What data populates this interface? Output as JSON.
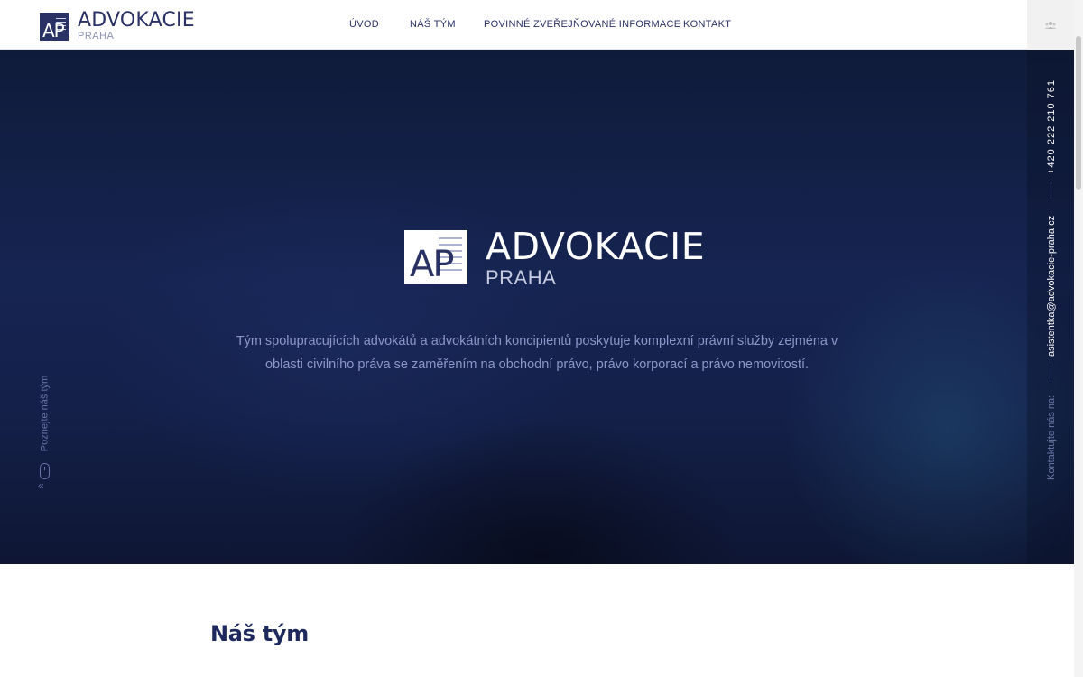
{
  "header": {
    "logo": {
      "mark": "AP",
      "title": "ADVOKACIE",
      "subtitle": "PRAHA"
    },
    "nav": [
      {
        "label": "ÚVOD"
      },
      {
        "label": "NÁŠ TÝM"
      },
      {
        "label": "POVINNÉ ZVEŘEJŇOVANÉ INFORMACE"
      },
      {
        "label": "KONTAKT"
      }
    ],
    "button_icon": "group-icon"
  },
  "hero": {
    "logo": {
      "mark": "AP",
      "title": "ADVOKACIE",
      "subtitle": "PRAHA"
    },
    "description": "Tým spolupracujících advokátů a advokátních koncipientů poskytuje komplexní právní služby zejména v oblasti civilního práva se zaměřením na obchodní právo, právo korporací a právo nemovitostí.",
    "scroll_hint": "Poznejte náš tým",
    "scroll_icon": "mouse-icon",
    "contact": {
      "phone": "+420 222 210 761",
      "email": "asistentka@advokacie-praha.cz",
      "label": "Kontaktujte nás na:"
    }
  },
  "section": {
    "title": "Náš tým"
  },
  "colors": {
    "brand": "#2a3164",
    "hero_text": "#8d96c8",
    "accent_light": "#ffffff"
  }
}
